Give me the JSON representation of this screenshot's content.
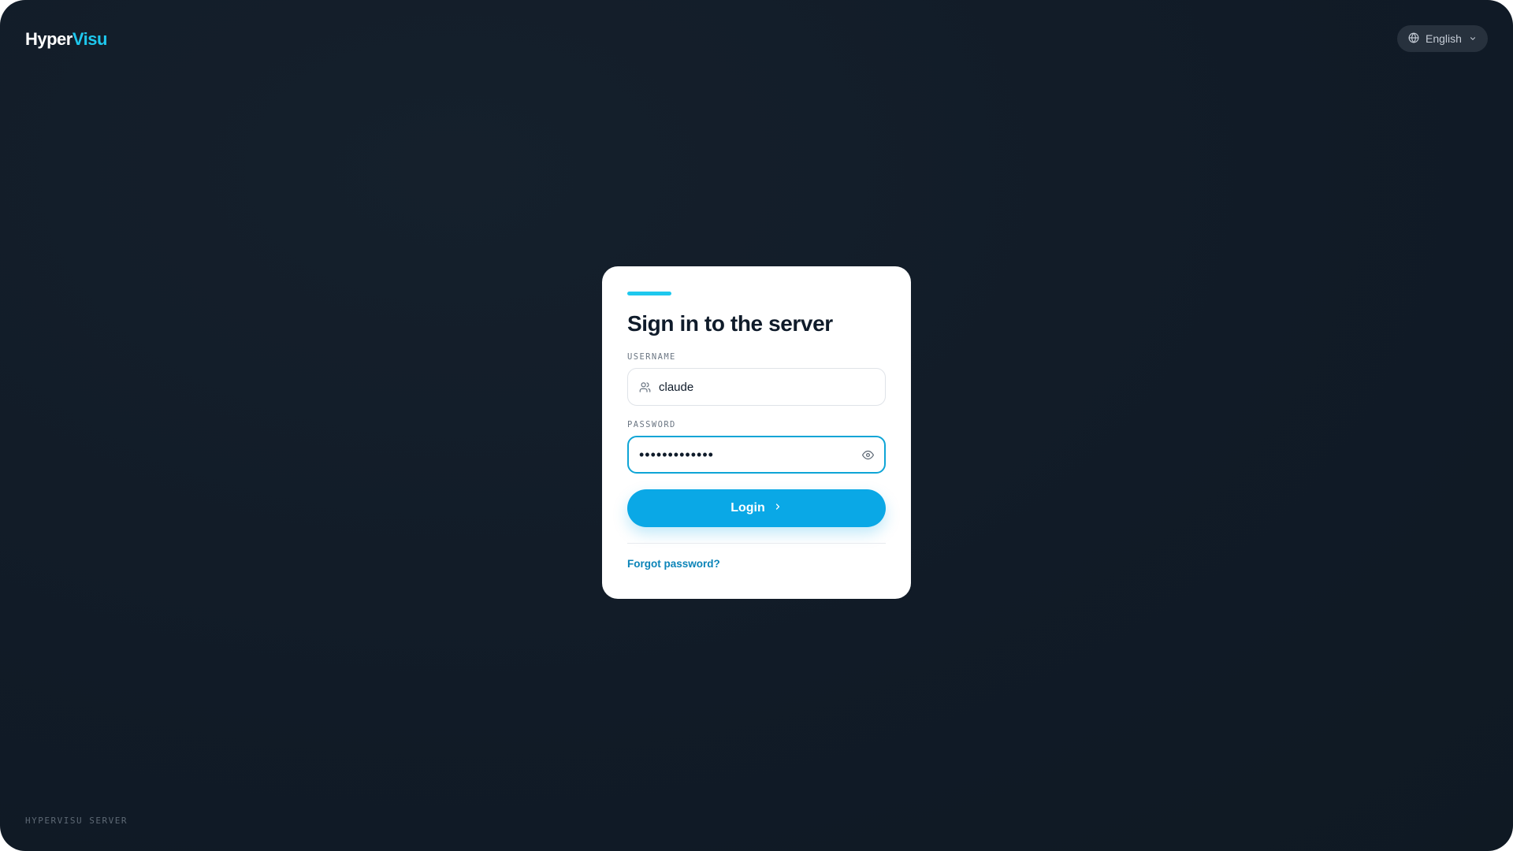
{
  "brand": {
    "name_primary": "Hyper",
    "name_accent": "Visu",
    "accent_color": "#1ec8ee"
  },
  "language": {
    "selected": "English",
    "icon": "globe-icon",
    "chevron": "chevron-down-icon"
  },
  "login_card": {
    "title": "Sign in to the server",
    "username": {
      "label": "USERNAME",
      "value": "claude",
      "icon": "user-icon"
    },
    "password": {
      "label": "PASSWORD",
      "masked_value": "•••••••••••••",
      "toggle_icon": "eye-icon"
    },
    "login_button": {
      "label": "Login",
      "icon": "chevron-right-icon",
      "color": "#0aa8e6"
    },
    "forgot_link": "Forgot password?"
  },
  "footer": {
    "text": "HYPERVISU SERVER"
  }
}
